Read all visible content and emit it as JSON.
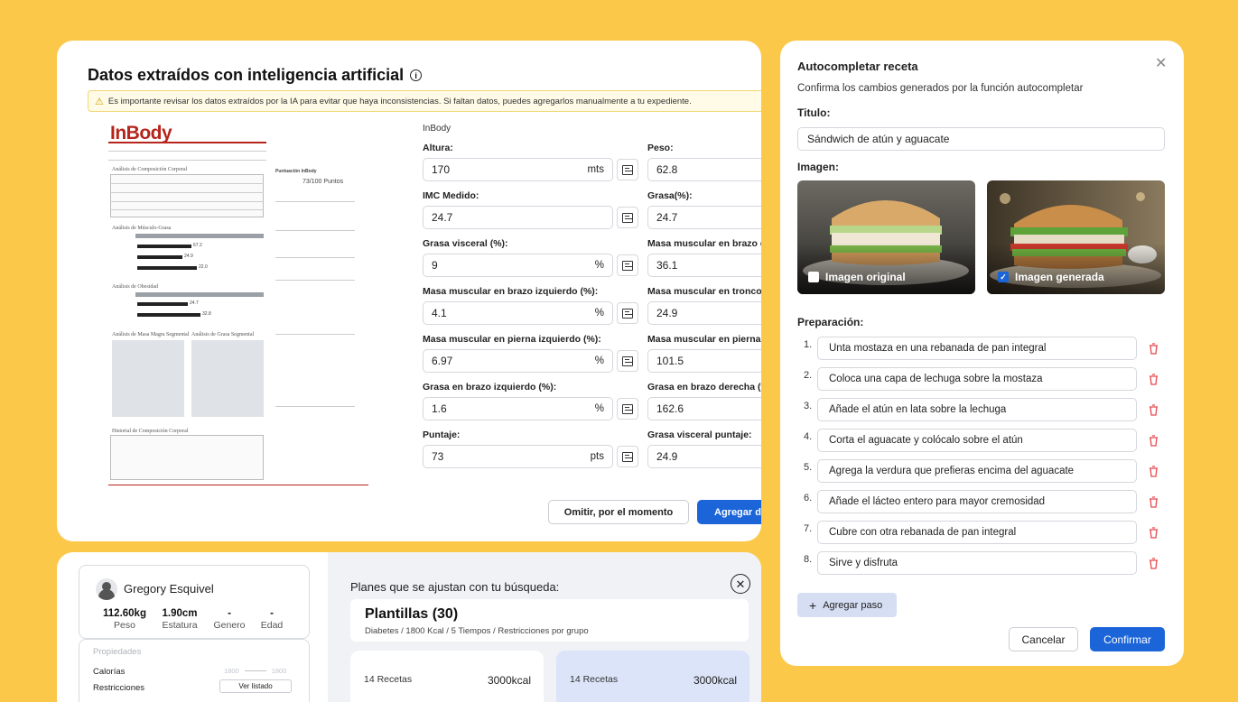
{
  "extract_card": {
    "title": "Datos extraídos con inteligencia artificial",
    "warning": "Es importante revisar los datos extraídos por la IA para evitar que haya inconsistencias. Si faltan datos, puedes agregarlos manualmente a tu expediente.",
    "source_label": "InBody",
    "document": {
      "logo": "InBody",
      "sections": [
        "Análisis de Composición Corporal",
        "Análisis de Músculo-Grasa",
        "Análisis de Obesidad",
        "Análisis de Masa Magra Segmental",
        "Análisis de Grasa Segmental",
        "Historial de Composición Corporal"
      ],
      "score_label": "Puntuación InBody",
      "score_value": "73/100 Puntos",
      "weight_value": "67.2",
      "smm_value": "24.9",
      "bfm_value": "22.0",
      "imc_value": "24.7",
      "pgc_value": "32.8"
    },
    "fields": [
      {
        "label": "Altura:",
        "value": "170",
        "unit": "mts"
      },
      {
        "label": "Peso:",
        "value": "62.8",
        "unit": ""
      },
      {
        "label": "IMC Medido:",
        "value": "24.7",
        "unit": ""
      },
      {
        "label": "Grasa(%):",
        "value": "24.7",
        "unit": ""
      },
      {
        "label": "Grasa visceral (%):",
        "value": "9",
        "unit": "%"
      },
      {
        "label": "Masa muscular en brazo derecho (%):",
        "value": "36.1",
        "unit": ""
      },
      {
        "label": "Masa muscular en brazo izquierdo (%):",
        "value": "4.1",
        "unit": "%"
      },
      {
        "label": "Masa muscular en tronco (%):",
        "value": "24.9",
        "unit": ""
      },
      {
        "label": "Masa muscular en pierna izquierdo (%):",
        "value": "6.97",
        "unit": "%"
      },
      {
        "label": "Masa muscular en pierna derecha (%):",
        "value": "101.5",
        "unit": ""
      },
      {
        "label": "Grasa en brazo izquierdo (%):",
        "value": "1.6",
        "unit": "%"
      },
      {
        "label": "Grasa en brazo derecha (%):",
        "value": "162.6",
        "unit": ""
      },
      {
        "label": "Puntaje:",
        "value": "73",
        "unit": "pts"
      },
      {
        "label": "Grasa visceral puntaje:",
        "value": "24.9",
        "unit": ""
      }
    ],
    "skip_button": "Omitir, por el momento",
    "add_button": "Agregar datos"
  },
  "profile_card": {
    "name": "Gregory Esquivel",
    "stats": [
      {
        "value": "112.60kg",
        "label": "Peso"
      },
      {
        "value": "1.90cm",
        "label": "Estatura"
      },
      {
        "value": "-",
        "label": "Genero"
      },
      {
        "value": "-",
        "label": "Edad"
      }
    ],
    "properties_title": "Propiedades",
    "calories_label": "Calorías",
    "calories_min": "1800",
    "calories_max": "1800",
    "restrictions_label": "Restricciones",
    "view_list_button": "Ver listado",
    "plans_heading": "Planes que se ajustan con tu búsqueda:",
    "templates_title": "Plantillas (30)",
    "templates_subtitle": "Diabetes / 1800 Kcal / 5 Tiempos / Restricciones por grupo",
    "recipe_cards": [
      {
        "recipes": "14 Recetas",
        "kcal": "3000kcal"
      },
      {
        "recipes": "14 Recetas",
        "kcal": "3000kcal"
      }
    ]
  },
  "recipe_dialog": {
    "title": "Autocompletar receta",
    "subtitle": "Confirma los cambios generados por la función autocompletar",
    "title_label": "Titulo:",
    "title_value": "Sándwich de atún y aguacate",
    "image_label": "Imagen:",
    "original_image_label": "Imagen original",
    "generated_image_label": "Imagen generada",
    "preparation_label": "Preparación:",
    "steps": [
      "Unta mostaza en una rebanada de pan integral",
      "Coloca una capa de lechuga sobre la mostaza",
      "Añade el atún en lata sobre la lechuga",
      "Corta el aguacate y colócalo sobre el atún",
      "Agrega la verdura que prefieras encima del aguacate",
      "Añade el lácteo entero para mayor cremosidad",
      "Cubre con otra rebanada de pan integral",
      "Sirve y disfruta"
    ],
    "add_step_button": "Agregar paso",
    "cancel_button": "Cancelar",
    "confirm_button": "Confirmar"
  },
  "colors": {
    "background": "#fcc84a",
    "primary": "#1b65d8",
    "inbody_red": "#b5251c",
    "danger": "#e5484d"
  }
}
